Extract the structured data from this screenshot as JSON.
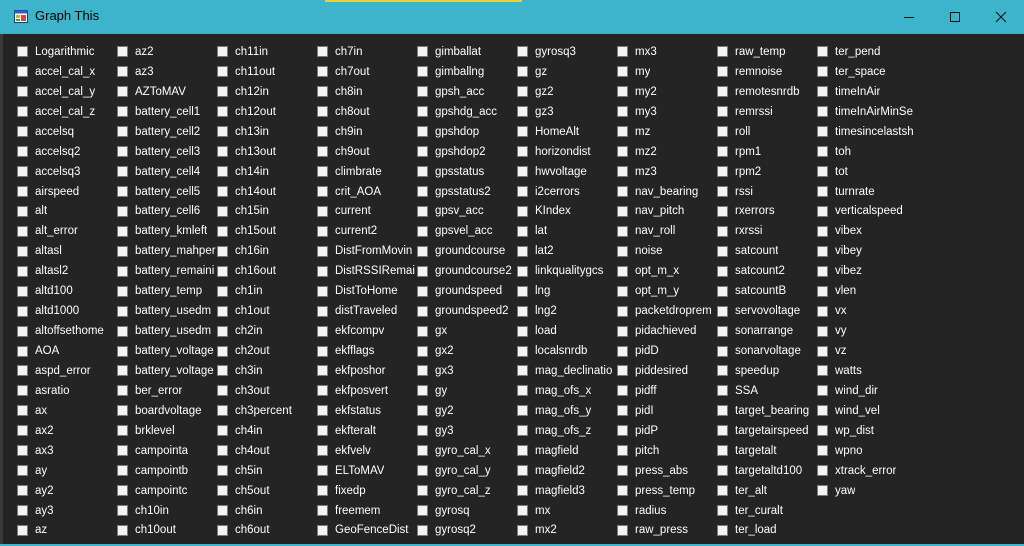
{
  "window": {
    "title": "Graph This",
    "icon": "graph-app-icon",
    "controls": [
      "minimize-icon",
      "maximize-icon",
      "close-icon"
    ]
  },
  "colors": {
    "titlebar": "#3cb4c9",
    "background": "#242424",
    "text": "#ffffff",
    "checkbox": "#f4f4f4"
  },
  "columns": [
    [
      "Logarithmic",
      "accel_cal_x",
      "accel_cal_y",
      "accel_cal_z",
      "accelsq",
      "accelsq2",
      "accelsq3",
      "airspeed",
      "alt",
      "alt_error",
      "altasl",
      "altasl2",
      "altd100",
      "altd1000",
      "altoffsethome",
      "AOA",
      "aspd_error",
      "asratio",
      "ax",
      "ax2",
      "ax3",
      "ay",
      "ay2",
      "ay3",
      "az"
    ],
    [
      "az2",
      "az3",
      "AZToMAV",
      "battery_cell1",
      "battery_cell2",
      "battery_cell3",
      "battery_cell4",
      "battery_cell5",
      "battery_cell6",
      "battery_kmleft",
      "battery_mahper",
      "battery_remaini",
      "battery_temp",
      "battery_usedm",
      "battery_usedm",
      "battery_voltage",
      "battery_voltage",
      "ber_error",
      "boardvoltage",
      "brklevel",
      "campointa",
      "campointb",
      "campointc",
      "ch10in",
      "ch10out"
    ],
    [
      "ch11in",
      "ch11out",
      "ch12in",
      "ch12out",
      "ch13in",
      "ch13out",
      "ch14in",
      "ch14out",
      "ch15in",
      "ch15out",
      "ch16in",
      "ch16out",
      "ch1in",
      "ch1out",
      "ch2in",
      "ch2out",
      "ch3in",
      "ch3out",
      "ch3percent",
      "ch4in",
      "ch4out",
      "ch5in",
      "ch5out",
      "ch6in",
      "ch6out"
    ],
    [
      "ch7in",
      "ch7out",
      "ch8in",
      "ch8out",
      "ch9in",
      "ch9out",
      "climbrate",
      "crit_AOA",
      "current",
      "current2",
      "DistFromMovin",
      "DistRSSIRemai",
      "DistToHome",
      "distTraveled",
      "ekfcompv",
      "ekfflags",
      "ekfposhor",
      "ekfposvert",
      "ekfstatus",
      "ekfteralt",
      "ekfvelv",
      "ELToMAV",
      "fixedp",
      "freemem",
      "GeoFenceDist"
    ],
    [
      "gimballat",
      "gimballng",
      "gpsh_acc",
      "gpshdg_acc",
      "gpshdop",
      "gpshdop2",
      "gpsstatus",
      "gpsstatus2",
      "gpsv_acc",
      "gpsvel_acc",
      "groundcourse",
      "groundcourse2",
      "groundspeed",
      "groundspeed2",
      "gx",
      "gx2",
      "gx3",
      "gy",
      "gy2",
      "gy3",
      "gyro_cal_x",
      "gyro_cal_y",
      "gyro_cal_z",
      "gyrosq",
      "gyrosq2"
    ],
    [
      "gyrosq3",
      "gz",
      "gz2",
      "gz3",
      "HomeAlt",
      "horizondist",
      "hwvoltage",
      "i2cerrors",
      "KIndex",
      "lat",
      "lat2",
      "linkqualitygcs",
      "lng",
      "lng2",
      "load",
      "localsnrdb",
      "mag_declinatio",
      "mag_ofs_x",
      "mag_ofs_y",
      "mag_ofs_z",
      "magfield",
      "magfield2",
      "magfield3",
      "mx",
      "mx2"
    ],
    [
      "mx3",
      "my",
      "my2",
      "my3",
      "mz",
      "mz2",
      "mz3",
      "nav_bearing",
      "nav_pitch",
      "nav_roll",
      "noise",
      "opt_m_x",
      "opt_m_y",
      "packetdroprem",
      "pidachieved",
      "pidD",
      "piddesired",
      "pidff",
      "pidI",
      "pidP",
      "pitch",
      "press_abs",
      "press_temp",
      "radius",
      "raw_press"
    ],
    [
      "raw_temp",
      "remnoise",
      "remotesnrdb",
      "remrssi",
      "roll",
      "rpm1",
      "rpm2",
      "rssi",
      "rxerrors",
      "rxrssi",
      "satcount",
      "satcount2",
      "satcountB",
      "servovoltage",
      "sonarrange",
      "sonarvoltage",
      "speedup",
      "SSA",
      "target_bearing",
      "targetairspeed",
      "targetalt",
      "targetaltd100",
      "ter_alt",
      "ter_curalt",
      "ter_load"
    ],
    [
      "ter_pend",
      "ter_space",
      "timeInAir",
      "timeInAirMinSe",
      "timesincelastsh",
      "toh",
      "tot",
      "turnrate",
      "verticalspeed",
      "vibex",
      "vibey",
      "vibez",
      "vlen",
      "vx",
      "vy",
      "vz",
      "watts",
      "wind_dir",
      "wind_vel",
      "wp_dist",
      "wpno",
      "xtrack_error",
      "yaw"
    ]
  ]
}
